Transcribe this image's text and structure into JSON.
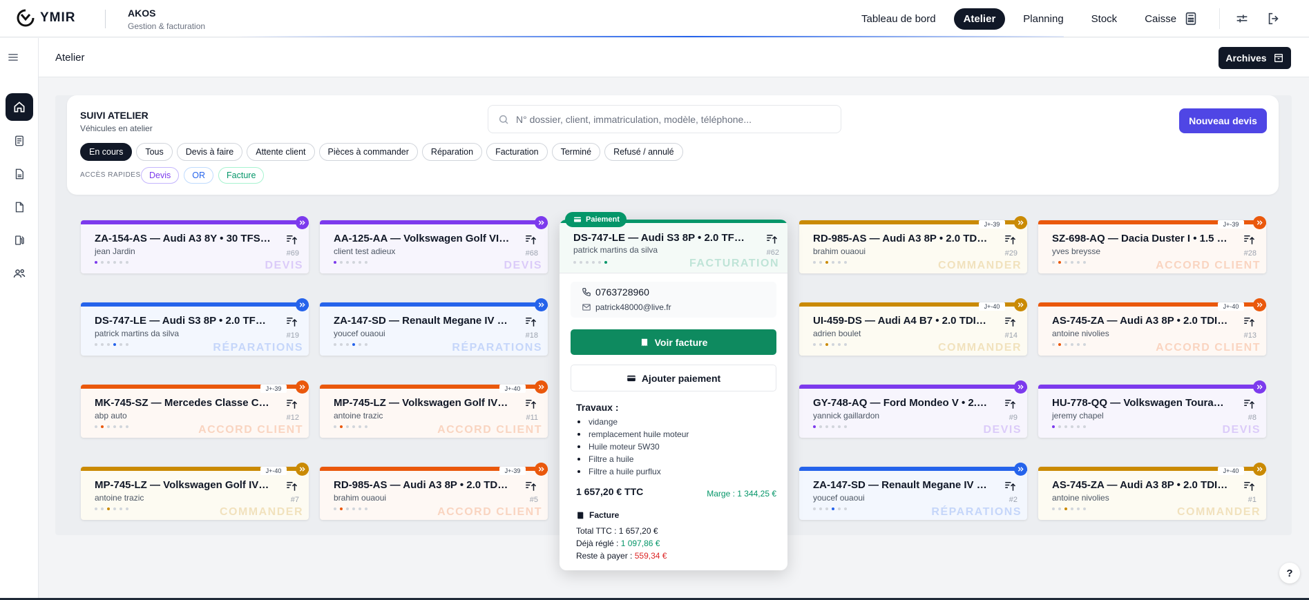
{
  "header": {
    "brand": "YMIR",
    "app_title": "AKOS",
    "app_subtitle": "Gestion & facturation",
    "nav": [
      {
        "label": "Tableau de bord",
        "active": false
      },
      {
        "label": "Atelier",
        "active": true
      },
      {
        "label": "Planning",
        "active": false
      },
      {
        "label": "Stock",
        "active": false
      },
      {
        "label": "Caisse",
        "active": false
      }
    ],
    "icons": [
      "calculator-icon",
      "sliders-icon",
      "logout-icon"
    ]
  },
  "sidebar": {
    "items": [
      "home-icon",
      "document-icon",
      "file-icon",
      "blank-file-icon",
      "fuel-icon",
      "users-icon"
    ],
    "active_index": 0
  },
  "subheader": {
    "breadcrumb": "Atelier",
    "archives_label": "Archives"
  },
  "filters": {
    "title": "SUIVI ATELIER",
    "subtitle": "Véhicules en atelier",
    "search_placeholder": "N° dossier, client, immatriculation, modèle, téléphone...",
    "new_button": "Nouveau devis",
    "chips": [
      "En cours",
      "Tous",
      "Devis à faire",
      "Attente client",
      "Pièces à commander",
      "Réparation",
      "Facturation",
      "Terminé",
      "Refusé / annulé"
    ],
    "active_chip": 0,
    "quick_label": "ACCÈS RAPIDES",
    "quick": [
      {
        "label": "Devis",
        "color": "#7c3aed"
      },
      {
        "label": "OR",
        "color": "#2563eb"
      },
      {
        "label": "Facture",
        "color": "#059669"
      }
    ]
  },
  "colors": {
    "devis": "#7c3aed",
    "reparations": "#2563eb",
    "commander": "#ca8a04",
    "accord": "#ea580c",
    "facturation": "#059669"
  },
  "cards": [
    {
      "title": "ZA-154-AS — Audi A3 8Y • 30 TFSI 110...",
      "client": "jean Jardin",
      "num": "#69",
      "stage": "DEVIS",
      "kind": "devis",
      "jtag": "",
      "step": 0
    },
    {
      "title": "AA-125-AA — Volkswagen Golf VIII • 1....",
      "client": "client test adieux",
      "num": "#68",
      "stage": "DEVIS",
      "kind": "devis",
      "jtag": "",
      "step": 0
    },
    {
      "title": "RD-985-AS — Audi A3 8P • 2.0 TDI • 1...",
      "client": "brahim ouaoui",
      "num": "#29",
      "stage": "COMMANDER",
      "kind": "commander",
      "jtag": "J+-39",
      "step": 2
    },
    {
      "title": "SZ-698-AQ — Dacia Duster I • 1.5 dCi ...",
      "client": "yves breysse",
      "num": "#28",
      "stage": "ACCORD CLIENT",
      "kind": "accord",
      "jtag": "J+-39",
      "step": 1
    },
    {
      "title": "DS-747-LE — Audi S3 8P • 2.0 TFSI 26...",
      "client": "patrick martins da silva",
      "num": "#19",
      "stage": "RÉPARATIONS",
      "kind": "reparations",
      "jtag": "",
      "step": 3
    },
    {
      "title": "ZA-147-SD — Renault Megane IV • 1.6 ...",
      "client": "youcef ouaoui",
      "num": "#18",
      "stage": "RÉPARATIONS",
      "kind": "reparations",
      "jtag": "",
      "step": 3
    },
    {
      "title": "UI-459-DS — Audi A4 B7 • 2.0 TDI 170...",
      "client": "adrien boulet",
      "num": "#14",
      "stage": "COMMANDER",
      "kind": "commander",
      "jtag": "J+-40",
      "step": 2
    },
    {
      "title": "AS-745-ZA — Audi A3 8P • 2.0 TDI • 1...",
      "client": "antoine nivolies",
      "num": "#13",
      "stage": "ACCORD CLIENT",
      "kind": "accord",
      "jtag": "J+-40",
      "step": 1
    },
    {
      "title": "MK-745-SZ — Mercedes Classe C W20...",
      "client": "abp auto",
      "num": "#12",
      "stage": "ACCORD CLIENT",
      "kind": "accord",
      "jtag": "J+-39",
      "step": 1
    },
    {
      "title": "MP-745-LZ — Volkswagen Golf IV • 1....",
      "client": "antoine trazic",
      "num": "#11",
      "stage": "ACCORD CLIENT",
      "kind": "accord",
      "jtag": "J+-40",
      "step": 1
    },
    {
      "title": "GY-748-AQ — Ford Mondeo V • 2.0 Ec...",
      "client": "yannick gaillardon",
      "num": "#9",
      "stage": "DEVIS",
      "kind": "devis",
      "jtag": "",
      "step": 0
    },
    {
      "title": "HU-778-QQ — Volkswagen Touran I • ...",
      "client": "jeremy chapel",
      "num": "#8",
      "stage": "DEVIS",
      "kind": "devis",
      "jtag": "",
      "step": 0
    },
    {
      "title": "MP-745-LZ — Volkswagen Golf IV • 1....",
      "client": "antoine trazic",
      "num": "#7",
      "stage": "COMMANDER",
      "kind": "commander",
      "jtag": "J+-40",
      "step": 2
    },
    {
      "title": "RD-985-AS — Audi A3 8P • 2.0 TDI • 1...",
      "client": "brahim ouaoui",
      "num": "#5",
      "stage": "ACCORD CLIENT",
      "kind": "accord",
      "jtag": "J+-39",
      "step": 1
    },
    {
      "title": "ZA-147-SD — Renault Megane IV • 1.6 ...",
      "client": "youcef ouaoui",
      "num": "#2",
      "stage": "RÉPARATIONS",
      "kind": "reparations",
      "jtag": "",
      "step": 3
    },
    {
      "title": "AS-745-ZA — Audi A3 8P • 2.0 TDI • 1...",
      "client": "antoine nivolies",
      "num": "#1",
      "stage": "COMMANDER",
      "kind": "commander",
      "jtag": "J+-40",
      "step": 2
    }
  ],
  "popup": {
    "badge": "Paiement",
    "title": "DS-747-LE — Audi S3 8P • 2.0 TFSI 26...",
    "client": "patrick martins da silva",
    "num": "#62",
    "stage": "FACTURATION",
    "step": 5,
    "phone": "0763728960",
    "email": "patrick48000@live.fr",
    "view_invoice": "Voir facture",
    "add_payment": "Ajouter paiement",
    "works_title": "Travaux :",
    "works": [
      "vidange",
      "remplacement huile moteur",
      "Huile moteur 5W30",
      "Filtre a huile",
      "Filtre a huile purflux"
    ],
    "total": "1 657,20 € TTC",
    "margin": "Marge : 1 344,25 €",
    "invoice_title": "Facture",
    "total_label": "Total TTC : ",
    "total_value": "1 657,20 €",
    "paid_label": "Déjà réglé : ",
    "paid_value": "1 097,86 €",
    "due_label": "Reste à payer : ",
    "due_value": "559,34 €"
  },
  "help_label": "?"
}
